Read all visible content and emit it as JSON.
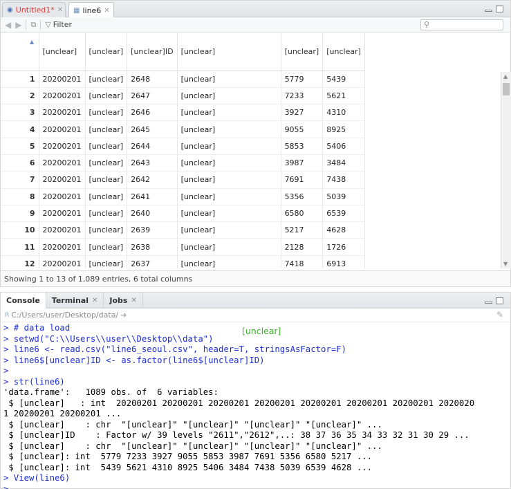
{
  "editor": {
    "tabs": [
      {
        "label": "Untitled1*"
      },
      {
        "label": "line6"
      }
    ],
    "filter_label": "Filter",
    "search_placeholder": ""
  },
  "grid": {
    "columns": [
      "[unclear]",
      "[unclear]",
      "[unclear]ID",
      "[unclear]",
      "[unclear]",
      "[unclear]"
    ],
    "rows": [
      [
        "1",
        "20200201",
        "[unclear]",
        "2648",
        "[unclear]",
        "5779",
        "5439"
      ],
      [
        "2",
        "20200201",
        "[unclear]",
        "2647",
        "[unclear]",
        "7233",
        "5621"
      ],
      [
        "3",
        "20200201",
        "[unclear]",
        "2646",
        "[unclear]",
        "3927",
        "4310"
      ],
      [
        "4",
        "20200201",
        "[unclear]",
        "2645",
        "[unclear]",
        "9055",
        "8925"
      ],
      [
        "5",
        "20200201",
        "[unclear]",
        "2644",
        "[unclear]",
        "5853",
        "5406"
      ],
      [
        "6",
        "20200201",
        "[unclear]",
        "2643",
        "[unclear]",
        "3987",
        "3484"
      ],
      [
        "7",
        "20200201",
        "[unclear]",
        "2642",
        "[unclear]",
        "7691",
        "7438"
      ],
      [
        "8",
        "20200201",
        "[unclear]",
        "2641",
        "[unclear]",
        "5356",
        "5039"
      ],
      [
        "9",
        "20200201",
        "[unclear]",
        "2640",
        "[unclear]",
        "6580",
        "6539"
      ],
      [
        "10",
        "20200201",
        "[unclear]",
        "2639",
        "[unclear]",
        "5217",
        "4628"
      ],
      [
        "11",
        "20200201",
        "[unclear]",
        "2638",
        "[unclear]",
        "2128",
        "1726"
      ],
      [
        "12",
        "20200201",
        "[unclear]",
        "2637",
        "[unclear]",
        "7418",
        "6913"
      ]
    ],
    "status": "Showing 1 to 13 of 1,089 entries, 6 total columns"
  },
  "console_pane": {
    "tabs": [
      {
        "label": "Console"
      },
      {
        "label": "Terminal"
      },
      {
        "label": "Jobs"
      }
    ],
    "path": "C:/Users/user/Desktop/data/",
    "annotation": "[unclear]",
    "lines": [
      {
        "type": "in",
        "text": "> # data load"
      },
      {
        "type": "in",
        "text": "> setwd(\"C:\\\\Users\\\\user\\\\Desktop\\\\data\")"
      },
      {
        "type": "in",
        "text": "> line6 <- read.csv(\"line6_seoul.csv\", header=T, stringsAsFactor=F)"
      },
      {
        "type": "in",
        "text": "> line6$[unclear]ID <- as.factor(line6$[unclear]ID)"
      },
      {
        "type": "in",
        "text": ">"
      },
      {
        "type": "in",
        "text": "> str(line6)"
      },
      {
        "type": "out",
        "text": "'data.frame':   1089 obs. of  6 variables:"
      },
      {
        "type": "out",
        "text": " $ [unclear]   : int  20200201 20200201 20200201 20200201 20200201 20200201 20200201 2020020"
      },
      {
        "type": "out",
        "text": "1 20200201 20200201 ..."
      },
      {
        "type": "out",
        "text": " $ [unclear]    : chr  \"[unclear]\" \"[unclear]\" \"[unclear]\" \"[unclear]\" ..."
      },
      {
        "type": "out",
        "text": " $ [unclear]ID    : Factor w/ 39 levels \"2611\",\"2612\",..: 38 37 36 35 34 33 32 31 30 29 ..."
      },
      {
        "type": "out",
        "text": " $ [unclear]    : chr  \"[unclear]\" \"[unclear]\" \"[unclear]\" \"[unclear]\" ..."
      },
      {
        "type": "out",
        "text": " $ [unclear]: int  5779 7233 3927 9055 5853 3987 7691 5356 6580 5217 ..."
      },
      {
        "type": "out",
        "text": " $ [unclear]: int  5439 5621 4310 8925 5406 3484 7438 5039 6539 4628 ..."
      },
      {
        "type": "in",
        "text": "> View(line6)"
      },
      {
        "type": "in",
        "text": ">"
      }
    ]
  },
  "colors": {
    "unsaved_tab": "#d63b3b",
    "console_input": "#1d2fd6",
    "annotation": "#3fae2e"
  }
}
